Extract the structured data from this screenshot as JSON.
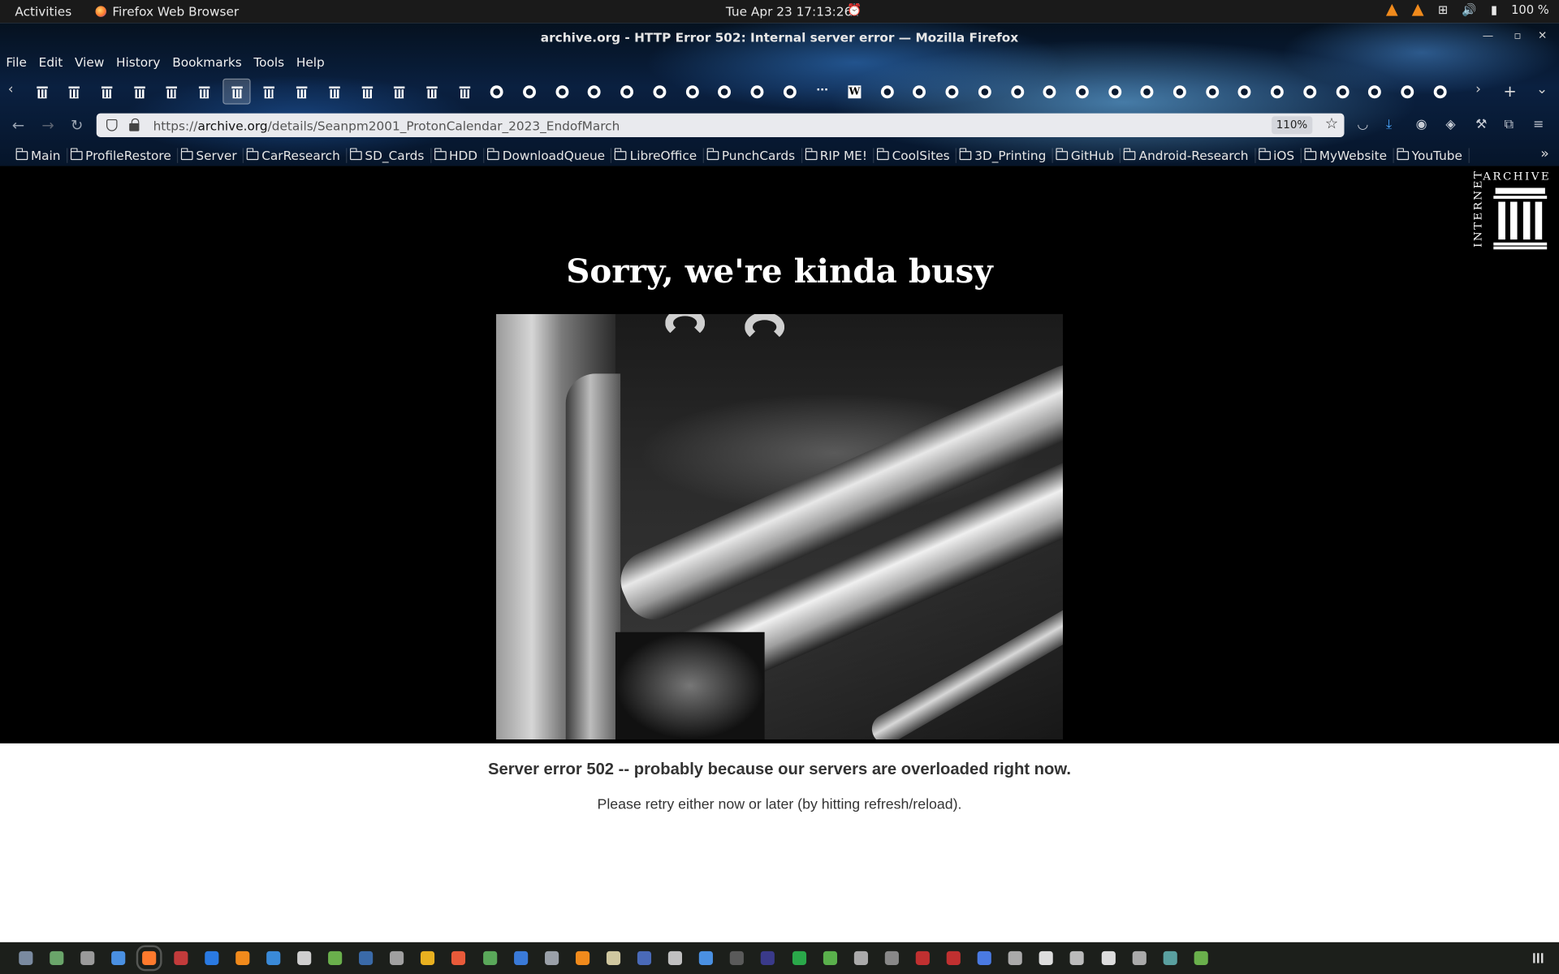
{
  "topbar": {
    "activities": "Activities",
    "app_name": "Firefox Web Browser",
    "clock": "Tue Apr 23  17:13:26",
    "battery": "100 %"
  },
  "window": {
    "title": "archive.org - HTTP Error 502: Internal server error — Mozilla Firefox"
  },
  "menu": {
    "items": [
      "File",
      "Edit",
      "View",
      "History",
      "Bookmarks",
      "Tools",
      "Help"
    ]
  },
  "tabs": {
    "icons": [
      "archive",
      "archive",
      "archive",
      "archive",
      "archive",
      "archive",
      "archive",
      "archive",
      "archive",
      "archive",
      "archive",
      "archive",
      "archive",
      "archive",
      "github",
      "github",
      "github",
      "github",
      "github",
      "github",
      "github",
      "github",
      "github",
      "github",
      "small",
      "wikipedia",
      "github",
      "github",
      "github",
      "github",
      "github",
      "github",
      "github",
      "github",
      "github",
      "github",
      "github",
      "github",
      "github",
      "github",
      "github",
      "github",
      "github",
      "github"
    ],
    "active_index": 6
  },
  "navbar": {
    "url_prefix": "https://",
    "url_host": "archive.org",
    "url_path": "/details/Seanpm2001_ProtonCalendar_2023_EndofMarch",
    "zoom": "110%"
  },
  "bookmarks": [
    "Main",
    "ProfileRestore",
    "Server",
    "CarResearch",
    "SD_Cards",
    "HDD",
    "DownloadQueue",
    "LibreOffice",
    "PunchCards",
    "RIP ME!",
    "CoolSites",
    "3D_Printing",
    "GitHub",
    "Android-Research",
    "iOS",
    "MyWebsite",
    "YouTube"
  ],
  "page": {
    "logo_top": "ARCHIVE",
    "logo_side": "INTERNET",
    "title": "Sorry, we're kinda busy",
    "error_main": "Server error 502 -- probably because our servers are overloaded right now.",
    "error_sub": "Please retry either now or later (by hitting refresh/reload)."
  },
  "dock": {
    "icon_colors": [
      "#7a8aa0",
      "#6aa56a",
      "#9a9a9a",
      "#4a90e2",
      "#ff7a2d",
      "#c23b3b",
      "#2a7ae2",
      "#f08a1c",
      "#3a8ad8",
      "#cfcfcf",
      "#6ab04c",
      "#3a6aa8",
      "#a0a0a0",
      "#e8b020",
      "#e85a3a",
      "#5aa85a",
      "#3a7ad8",
      "#9aa0a8",
      "#f08a1c",
      "#d0c8a0",
      "#4a6ab8",
      "#c0c0c0",
      "#4a90e2",
      "#5a5a5a",
      "#3a3a8a",
      "#2aa84a",
      "#5ab04c",
      "#aaaaaa",
      "#888888",
      "#c03030",
      "#c03030",
      "#4a7ae2",
      "#aaaaaa",
      "#dddddd",
      "#bbbbbb",
      "#dddddd",
      "#aaaaaa",
      "#5aa0a0",
      "#6ab04c"
    ]
  }
}
